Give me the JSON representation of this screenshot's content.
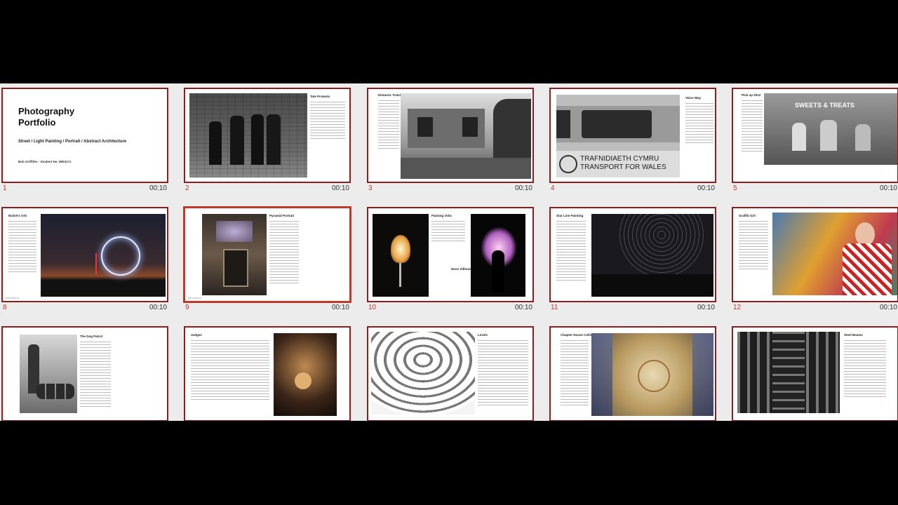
{
  "title_slide": {
    "title_line1": "Photography",
    "title_line2": "Portfolio",
    "subtitle": "Street / Light Painting / Portrait / Abstract Architecture",
    "author": "Bob Griffiths - Student No. 9903171"
  },
  "slides": [
    {
      "number": "1",
      "duration": "00:10"
    },
    {
      "number": "2",
      "duration": "00:10",
      "caption": "Tate Protests"
    },
    {
      "number": "3",
      "duration": "00:10",
      "caption": "Distance Training"
    },
    {
      "number": "4",
      "duration": "00:10",
      "caption": "Voice Way",
      "sign_line1": "TRAFNIDIAETH CYMRU",
      "sign_line2": "TRANSPORT FOR WALES"
    },
    {
      "number": "5",
      "duration": "00:10",
      "caption": "Pick up 2012",
      "sign": "SWEETS & TREATS"
    },
    {
      "number": "8",
      "duration": "00:10",
      "caption": "Nickel's Orb"
    },
    {
      "number": "9",
      "duration": "00:10",
      "caption": "Pyramid Portrait"
    },
    {
      "number": "10",
      "duration": "00:10",
      "caption": "Flaming Orbs",
      "caption2": "Neon Silhouette"
    },
    {
      "number": "11",
      "duration": "00:10",
      "caption": "Star Line Painting"
    },
    {
      "number": "12",
      "duration": "00:10",
      "caption": "Graffiti Girl"
    },
    {
      "number": "",
      "duration": "",
      "caption": "The Dog Patrol"
    },
    {
      "number": "",
      "duration": "",
      "caption": "Judges"
    },
    {
      "number": "",
      "duration": "",
      "caption": "Levels"
    },
    {
      "number": "",
      "duration": "",
      "caption": "Chapter House Ceiling"
    },
    {
      "number": "",
      "duration": "",
      "caption": "Steel Beams"
    }
  ]
}
